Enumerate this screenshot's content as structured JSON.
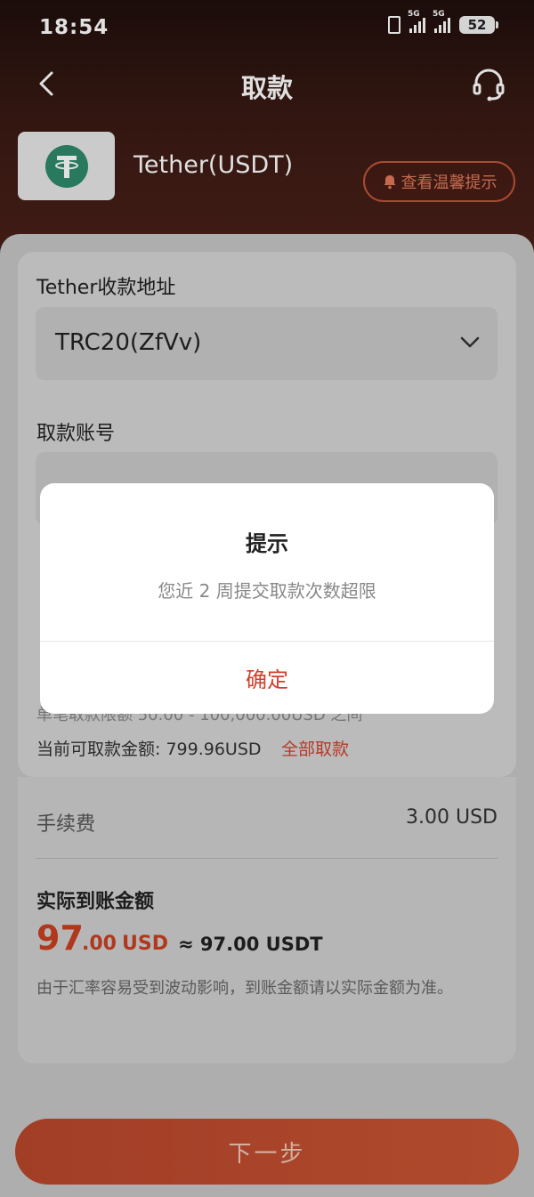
{
  "status_bar": {
    "time": "18:54",
    "net1": "5G",
    "net2": "5G",
    "battery": "52"
  },
  "nav": {
    "title": "取款"
  },
  "coin": {
    "name": "Tether(USDT)"
  },
  "tips_button": {
    "label": "查看温馨提示"
  },
  "form": {
    "address_label": "Tether收款地址",
    "address_value": "TRC20(ZfVv)",
    "account_label": "取款账号",
    "limit_text": "单笔取款限额 50.00 - 100,000.00USD 之间",
    "available_text": "当前可取款金额: 799.96USD",
    "withdraw_all": "全部取款"
  },
  "fees": {
    "fee_label": "手续费",
    "fee_value": "3.00 USD",
    "actual_label": "实际到账金额",
    "amount_int": "97",
    "amount_dec": ".00",
    "amount_currency": "USD",
    "approx": "≈ 97.00 USDT",
    "note": "由于汇率容易受到波动影响，到账金额请以实际金额为准。"
  },
  "next_button": {
    "label": "下一步"
  },
  "dialog": {
    "title": "提示",
    "message": "您近 2 周提交取款次数超限",
    "ok_label": "确定"
  },
  "colors": {
    "accent": "#c94021",
    "tether": "#2e8a6c"
  }
}
